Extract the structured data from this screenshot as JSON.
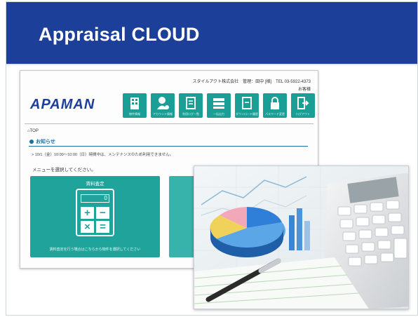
{
  "banner": {
    "title": "Appraisal CLOUD",
    "color": "#1c3f9a"
  },
  "screenshot": {
    "company": "スタイルアクト株式会社　管理：田中 [様]　TEL 03-5922-4373",
    "user": "お客様",
    "logo": "APAMAN",
    "nav": [
      {
        "icon": "building-icon",
        "label": "物件情報"
      },
      {
        "icon": "user-icon",
        "label": "アカウント情報"
      },
      {
        "icon": "document-icon",
        "label": "利用ログ一覧"
      },
      {
        "icon": "stack-icon",
        "label": "一括出力"
      },
      {
        "icon": "document-icon",
        "label": "ダウンロード履歴"
      },
      {
        "icon": "lock-icon",
        "label": "パスワード変更"
      },
      {
        "icon": "exit-icon",
        "label": "ログアウト"
      }
    ],
    "breadcrumb": "TOP",
    "notice_heading": "お知らせ",
    "notice_text": "> 10/1（金）10:00〜10:00（日）時間中は、メンテナンスのため利用できません。",
    "select_prompt": "メニューを選択してください。",
    "tile_title": "賃料査定",
    "calc_display": "0",
    "calc_keys": [
      "+",
      "−",
      "×",
      "="
    ],
    "tile_footer": "賃料査定を行う場合はこちらから物件を選択してください"
  }
}
